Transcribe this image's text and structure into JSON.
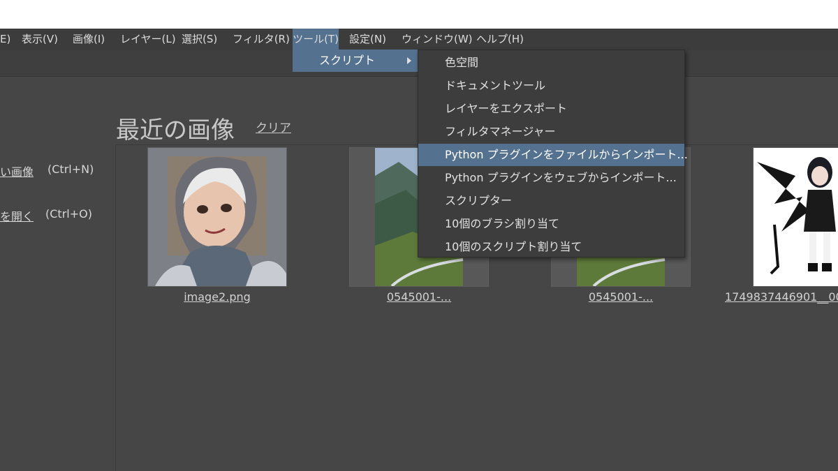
{
  "menubar": {
    "items": [
      {
        "label": "E)"
      },
      {
        "label": "表示(V)"
      },
      {
        "label": "画像(I)"
      },
      {
        "label": "レイヤー(L)"
      },
      {
        "label": "選択(S)"
      },
      {
        "label": "フィルタ(R)"
      },
      {
        "label": "ツール(T)"
      },
      {
        "label": "設定(N)"
      },
      {
        "label": "ウィンドウ(W)"
      },
      {
        "label": "ヘルプ(H)"
      }
    ]
  },
  "tools_menu": {
    "scripts_label": "スクリプト"
  },
  "scripts_submenu": {
    "items": [
      "色空間",
      "ドキュメントツール",
      "レイヤーをエクスポート",
      "フィルタマネージャー",
      "Python プラグインをファイルからインポート...",
      "Python プラグインをウェブからインポート...",
      "スクリプター",
      "10個のブラシ割り当て",
      "10個のスクリプト割り当て"
    ],
    "highlighted_index": 4
  },
  "welcome": {
    "recent_title": "最近の画像",
    "clear_label": "クリア",
    "new_image_label": "い画像",
    "new_image_shortcut": "(Ctrl+N)",
    "open_label": "を開く",
    "open_shortcut": "(Ctrl+O)"
  },
  "recent_images": [
    {
      "name": "image2.png"
    },
    {
      "name": "0545001-..."
    },
    {
      "name": "0545001-..."
    },
    {
      "name": "1749837446901__00"
    }
  ],
  "colors": {
    "background": "#464646",
    "menubar": "#3c3c3c",
    "highlight": "#54728f",
    "popup": "#3d3d3d"
  }
}
